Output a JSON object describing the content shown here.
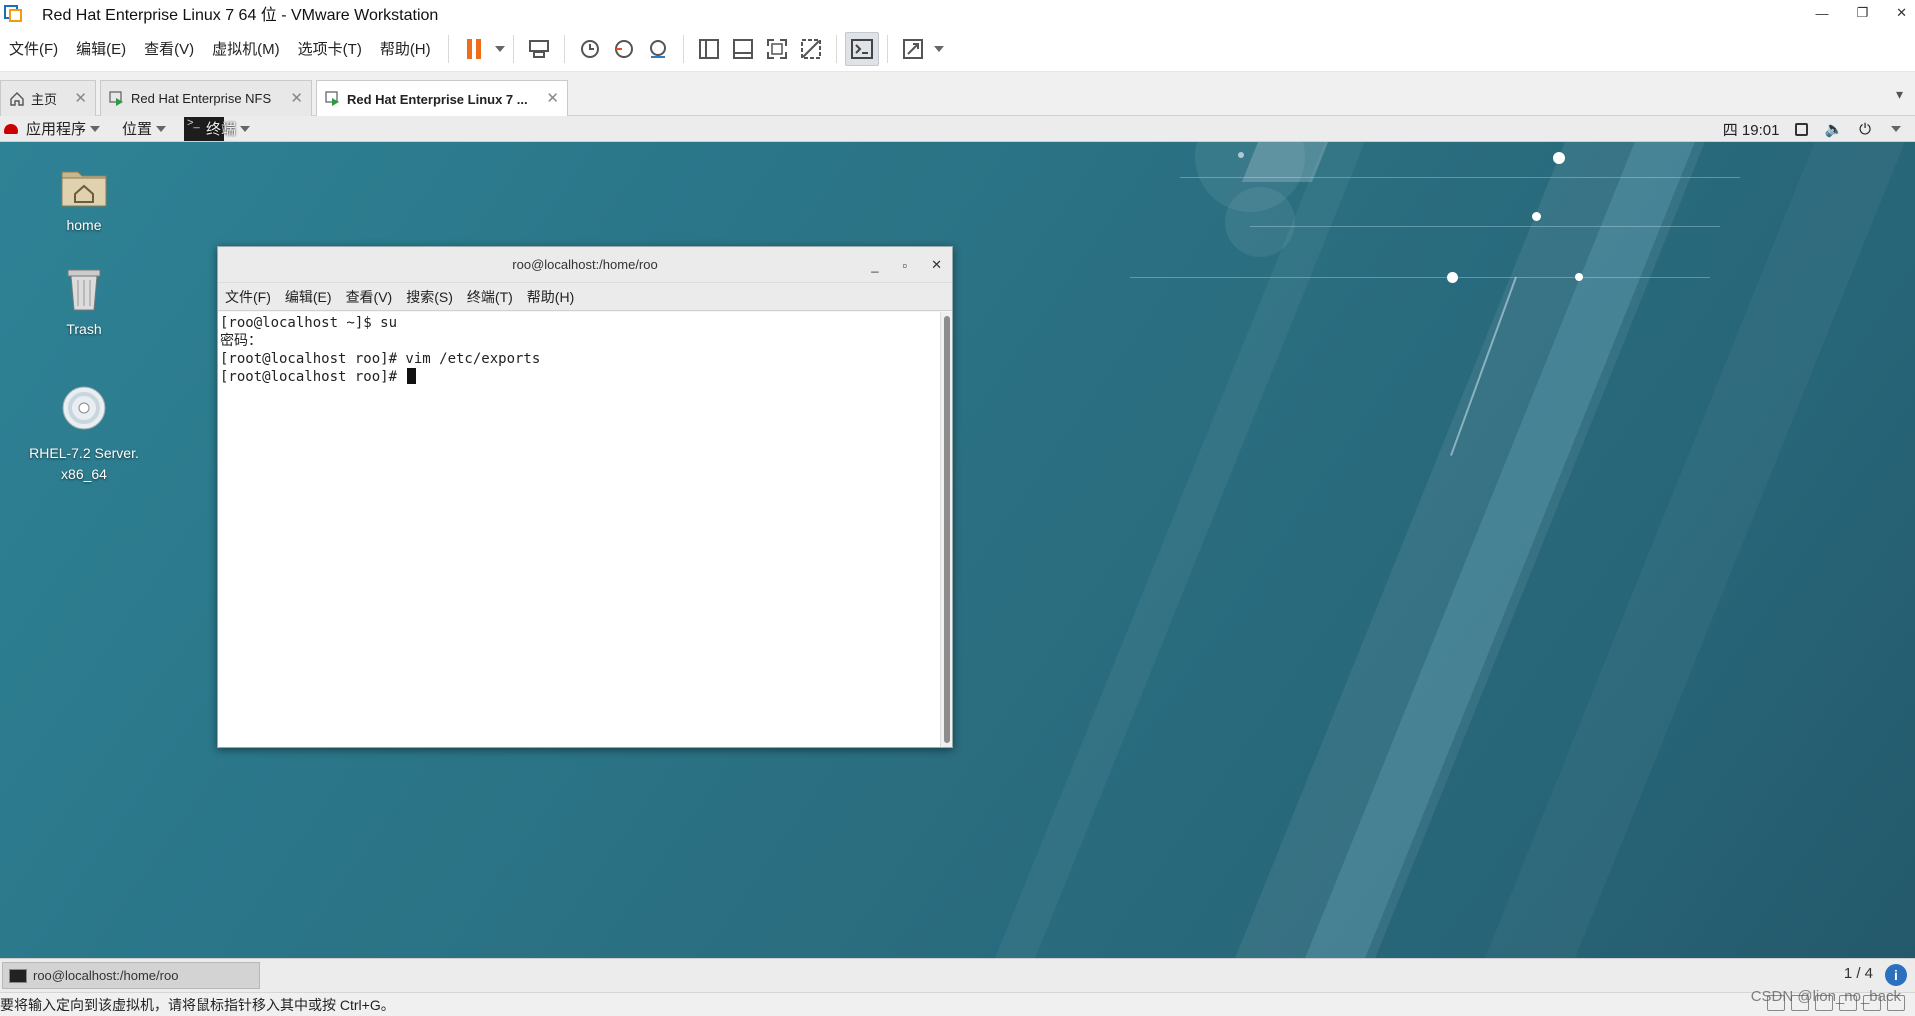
{
  "window": {
    "title": "Red Hat Enterprise Linux 7 64 位 - VMware Workstation"
  },
  "menubar": {
    "items": [
      "文件(F)",
      "编辑(E)",
      "查看(V)",
      "虚拟机(M)",
      "选项卡(T)",
      "帮助(H)"
    ]
  },
  "toolbar": {
    "icons": [
      "pause-icon",
      "send-ctrl-alt-del-icon",
      "snapshot-icon",
      "revert-snapshot-icon",
      "snapshot-manager-icon",
      "show-library-icon",
      "show-thumbnail-icon",
      "fullscreen-icon",
      "unity-icon",
      "console-view-icon",
      "stretch-icon"
    ]
  },
  "tabs": [
    {
      "label": "主页",
      "icon": "home-icon"
    },
    {
      "label": "Red Hat Enterprise NFS",
      "icon": "vm-icon"
    },
    {
      "label": "Red Hat Enterprise Linux 7 ...",
      "icon": "vm-icon",
      "active": true
    }
  ],
  "gnome_panel": {
    "applications": "应用程序",
    "places": "位置",
    "terminal": "终端",
    "clock": "四 19:01"
  },
  "desktop": {
    "icons": [
      {
        "label": "home"
      },
      {
        "label": "Trash"
      },
      {
        "label": "RHEL-7.2 Server.\nx86_64"
      }
    ]
  },
  "terminal": {
    "title": "roo@localhost:/home/roo",
    "menu": [
      "文件(F)",
      "编辑(E)",
      "查看(V)",
      "搜索(S)",
      "终端(T)",
      "帮助(H)"
    ],
    "lines": [
      "[roo@localhost ~]$ su",
      "密码：",
      "[root@localhost roo]# vim /etc/exports",
      "[root@localhost roo]# "
    ]
  },
  "bottom_panel": {
    "task": "roo@localhost:/home/roo",
    "workspace": "1 / 4"
  },
  "statusbar": {
    "text": "要将输入定向到该虚拟机，请将鼠标指针移入其中或按 Ctrl+G。",
    "watermark": "CSDN @lion_no_back"
  },
  "colors": {
    "pause_accent": "#ef6c1b",
    "desktop_bg": "#2b7689",
    "rh_red": "#cc0000"
  }
}
